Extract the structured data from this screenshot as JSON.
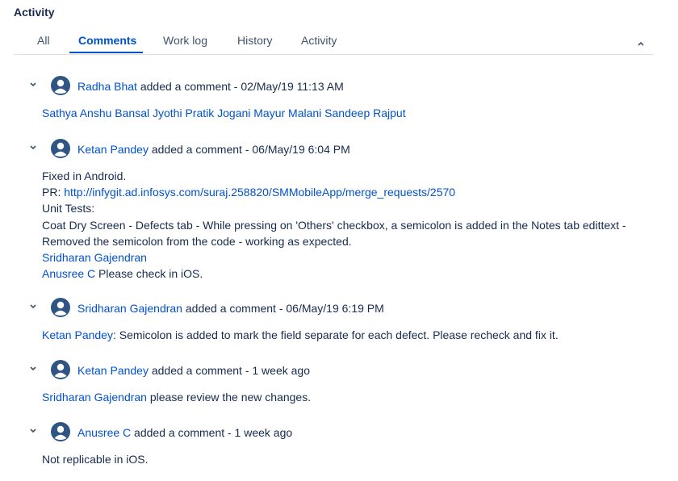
{
  "panel": {
    "title": "Activity"
  },
  "tabs": {
    "all": "All",
    "comments": "Comments",
    "work_log": "Work log",
    "history": "History",
    "activity": "Activity"
  },
  "icons": {
    "collapse": "chevron-up-icon",
    "expand": "chevron-down-icon",
    "avatar": "user-avatar-icon"
  },
  "colors": {
    "link": "#0052cc",
    "text": "#172b4d",
    "avatar": "#2f5585",
    "tab_underline": "#0052cc"
  },
  "comments": [
    {
      "author": "Radha Bhat",
      "meta": " added a comment - 02/May/19 11:13 AM",
      "mentions": "Sathya Anshu Bansal Jyothi Pratik Jogani Mayur Malani Sandeep Rajput"
    },
    {
      "author": "Ketan Pandey",
      "meta": " added a comment - 06/May/19 6:04 PM",
      "line1": "Fixed in Android.",
      "pr_label": "PR: ",
      "pr_link": "http://infygit.ad.infosys.com/suraj.258820/SMMobileApp/merge_requests/2570",
      "line3": "Unit Tests:",
      "line4": "Coat Dry Screen - Defects tab - While pressing on 'Others' checkbox, a semicolon is added in the Notes tab edittext -",
      "line5": "Removed the semicolon from the code - working as expected.",
      "mention1": "Sridharan Gajendran",
      "mention2": "Anusree C",
      "mention2_text": " Please check in iOS."
    },
    {
      "author": "Sridharan Gajendran",
      "meta": " added a comment - 06/May/19 6:19 PM",
      "mention": "Ketan Pandey",
      "text": ": Semicolon is added to mark the field separate for each defect. Please recheck and fix it."
    },
    {
      "author": "Ketan Pandey",
      "meta": " added a comment - 1 week ago",
      "mention": "Sridharan Gajendran",
      "text": " please review the new changes."
    },
    {
      "author": "Anusree C",
      "meta": " added a comment - 1 week ago",
      "text": "Not replicable in iOS."
    }
  ]
}
